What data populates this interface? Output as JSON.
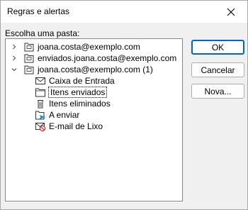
{
  "window": {
    "title": "Regras e alertas"
  },
  "folder_picker": {
    "label": "Escolha uma pasta:",
    "items": [
      {
        "label": "joana.costa@exemplo.com"
      },
      {
        "label": "enviados.joana.costa@exemplo.com"
      },
      {
        "label": "joana.costa@exemplo.com (1)"
      },
      {
        "label": "Caixa de Entrada"
      },
      {
        "label": "Itens enviados"
      },
      {
        "label": "Itens eliminados"
      },
      {
        "label": "A enviar"
      },
      {
        "label": "E-mail de Lixo"
      }
    ]
  },
  "buttons": {
    "ok": "OK",
    "cancel": "Cancelar",
    "new": "Nova..."
  },
  "colors": {
    "accent": "#0067c0",
    "focus_border": "#0067c0"
  }
}
